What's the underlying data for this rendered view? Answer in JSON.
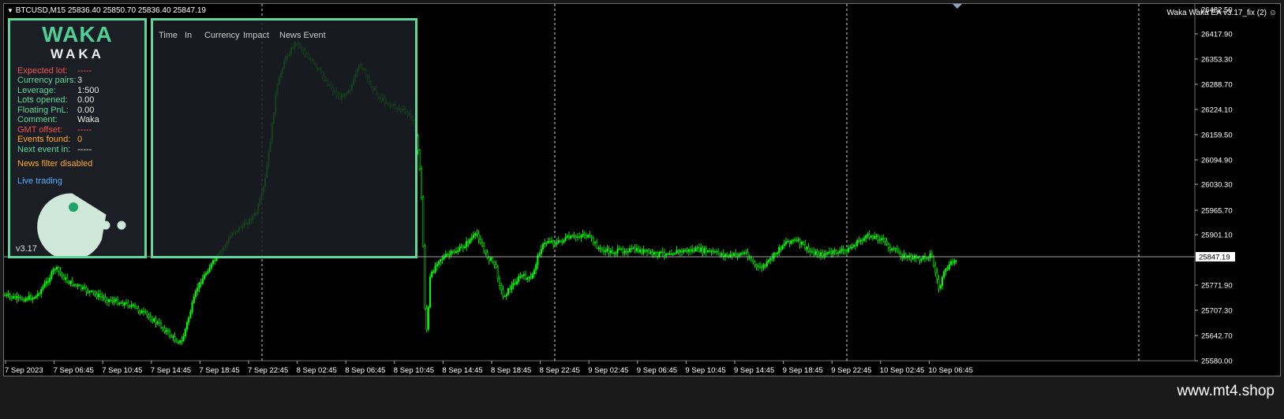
{
  "chart": {
    "header": "BTCUSD,M15  25836.40 25850.70 25836.40 25847.19",
    "ea_label": "Waka Waka EA  v3.17_fix (2)",
    "last_price": "25847.19",
    "price_ticks": [
      "26482.50",
      "26417.90",
      "26353.30",
      "26288.70",
      "26224.10",
      "26159.50",
      "26094.90",
      "26030.30",
      "25965.70",
      "25901.10",
      "25771.90",
      "25707.30",
      "25642.70",
      "25580.00"
    ],
    "time_ticks": [
      "7 Sep 2023",
      "7 Sep 06:45",
      "7 Sep 10:45",
      "7 Sep 14:45",
      "7 Sep 18:45",
      "7 Sep 22:45",
      "8 Sep 02:45",
      "8 Sep 06:45",
      "8 Sep 10:45",
      "8 Sep 14:45",
      "8 Sep 18:45",
      "8 Sep 22:45",
      "9 Sep 02:45",
      "9 Sep 06:45",
      "9 Sep 10:45",
      "9 Sep 14:45",
      "9 Sep 18:45",
      "9 Sep 22:45",
      "10 Sep 02:45",
      "10 Sep 06:45"
    ],
    "colors": {
      "candle": "#00ff00",
      "grid": "#ffffff",
      "bg": "#000000"
    }
  },
  "info_panel": {
    "logo_top": "WAKA",
    "logo_bottom": "WAKA",
    "rows": [
      {
        "label": "Expected lot:",
        "value": "-----"
      },
      {
        "label": "Currency pairs:",
        "value": "3"
      },
      {
        "label": "Leverage:",
        "value": "1:500"
      },
      {
        "label": "Lots opened:",
        "value": "0.00"
      },
      {
        "label": "Floating PnL:",
        "value": "0.00"
      },
      {
        "label": "Comment:",
        "value": "Waka"
      },
      {
        "label": "GMT offset:",
        "value": "-----"
      },
      {
        "label": "Events found:",
        "value": "0"
      },
      {
        "label": "Next event in:",
        "value": "-----"
      }
    ],
    "news_status": "News filter disabled",
    "mode": "Live trading",
    "version": "v3.17"
  },
  "news_panel": {
    "headers": [
      "Time",
      "In",
      "Currency",
      "Impact",
      "News Event"
    ]
  },
  "footer": {
    "watermark": "www.mt4.shop"
  }
}
